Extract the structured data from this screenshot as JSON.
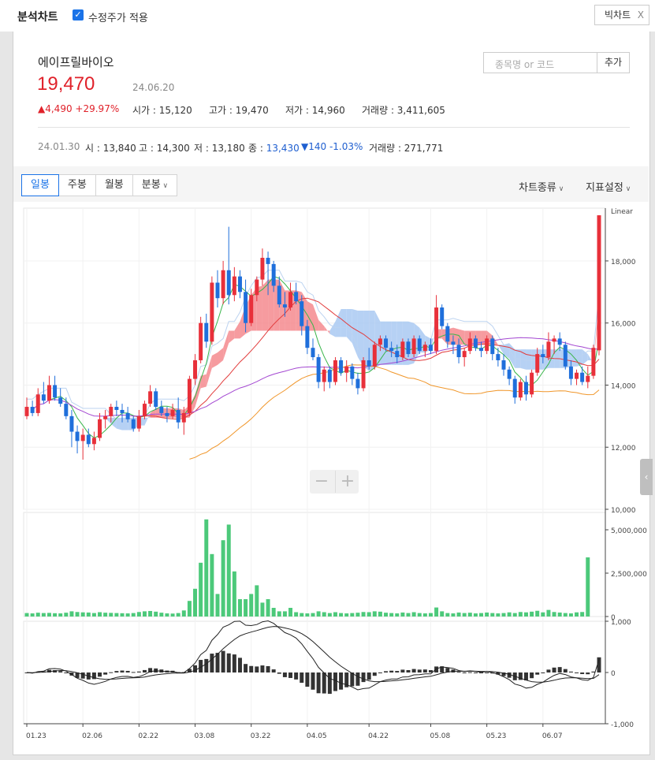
{
  "header": {
    "title": "분석차트",
    "adjust_label": "수정주가 적용",
    "big_chart_label": "빅차트",
    "close_glyph": "X"
  },
  "stock": {
    "name": "에이프릴바이오",
    "price": "19,470",
    "date": "24.06.20",
    "change": "4,490",
    "change_pct": "+29.97%",
    "open_label": "시가",
    "open": "15,120",
    "high_label": "고가",
    "high": "19,470",
    "low_label": "저가",
    "low": "14,960",
    "volume_label": "거래량",
    "volume": "3,411,605"
  },
  "search": {
    "placeholder": "종목명 or 코드",
    "add_label": "추가"
  },
  "history": {
    "date": "24.01.30",
    "open_label": "시",
    "open": "13,840",
    "high_label": "고",
    "high": "14,300",
    "low_label": "저",
    "low": "13,180",
    "close_label": "종",
    "close": "13,430",
    "change": "140",
    "change_pct": "-1.03%",
    "volume_label": "거래량",
    "volume": "271,771"
  },
  "tabs": [
    {
      "label": "일봉",
      "active": true
    },
    {
      "label": "주봉",
      "active": false
    },
    {
      "label": "월봉",
      "active": false
    },
    {
      "label": "분봉",
      "active": false
    }
  ],
  "menus": {
    "chart_type": "차트종류",
    "indicator": "지표설정"
  },
  "zoom": {
    "minus": "−",
    "plus": "+"
  },
  "colors": {
    "up": "#e8303a",
    "down": "#1f6fdb",
    "volume": "#4cc97a",
    "ma5": "#39b54a",
    "ma20": "#e23b3b",
    "ma60": "#a347d1",
    "ma120": "#f0962a",
    "cloud_up": "#f48a8e",
    "cloud_down": "#a9c9f2"
  },
  "chart_data": {
    "type": "candlestick",
    "price_axis": {
      "scale": "Linear",
      "ticks": [
        "18,000",
        "16,000",
        "14,000",
        "12,000",
        "10,000"
      ],
      "range": [
        10000,
        19700
      ]
    },
    "volume_axis": {
      "ticks": [
        "5,000,000",
        "2,500,000",
        "0"
      ],
      "range": [
        0,
        6000000
      ]
    },
    "macd_axis": {
      "ticks": [
        "1,000",
        "0",
        "-1,000"
      ],
      "range": [
        -1000,
        1000
      ]
    },
    "x_ticks": [
      "01.23",
      "02.06",
      "02.22",
      "03.08",
      "03.22",
      "04.05",
      "04.22",
      "05.08",
      "05.23",
      "06.07"
    ],
    "candles_ohlc": [
      [
        13000,
        13600,
        12900,
        13300
      ],
      [
        13300,
        13500,
        13000,
        13100
      ],
      [
        13100,
        13900,
        13000,
        13700
      ],
      [
        13700,
        14100,
        13400,
        13500
      ],
      [
        13500,
        14300,
        13400,
        14000
      ],
      [
        14000,
        14300,
        13500,
        13600
      ],
      [
        13600,
        13900,
        13300,
        13400
      ],
      [
        13400,
        13600,
        12900,
        13000
      ],
      [
        13000,
        13200,
        12000,
        12500
      ],
      [
        12500,
        12700,
        11800,
        12200
      ],
      [
        12200,
        12600,
        11600,
        12400
      ],
      [
        12400,
        12600,
        12000,
        12100
      ],
      [
        12100,
        12500,
        11900,
        12300
      ],
      [
        12300,
        13100,
        12200,
        12900
      ],
      [
        12900,
        13200,
        12600,
        13000
      ],
      [
        13000,
        13400,
        12800,
        13300
      ],
      [
        13300,
        13500,
        13000,
        13200
      ],
      [
        13200,
        13400,
        12800,
        13100
      ],
      [
        13100,
        13300,
        12800,
        12900
      ],
      [
        12900,
        13000,
        12500,
        12600
      ],
      [
        12600,
        13200,
        12500,
        13000
      ],
      [
        13000,
        13500,
        12900,
        13400
      ],
      [
        13400,
        14000,
        13300,
        13800
      ],
      [
        13800,
        13900,
        13200,
        13300
      ],
      [
        13300,
        13500,
        13000,
        13100
      ],
      [
        13100,
        13300,
        12800,
        13000
      ],
      [
        13000,
        13400,
        12900,
        13200
      ],
      [
        13200,
        13600,
        12600,
        12800
      ],
      [
        12800,
        13300,
        12400,
        13100
      ],
      [
        13100,
        14300,
        13000,
        14200
      ],
      [
        14200,
        15000,
        14000,
        14800
      ],
      [
        14800,
        16200,
        14700,
        16000
      ],
      [
        16000,
        16300,
        15200,
        15400
      ],
      [
        15400,
        17500,
        15300,
        17300
      ],
      [
        17300,
        17700,
        16500,
        16800
      ],
      [
        16800,
        18000,
        16600,
        17700
      ],
      [
        17700,
        19100,
        16600,
        16900
      ],
      [
        16900,
        17800,
        16700,
        17500
      ],
      [
        17500,
        17700,
        16800,
        17000
      ],
      [
        17000,
        17400,
        15700,
        16000
      ],
      [
        16000,
        17100,
        15900,
        16900
      ],
      [
        16900,
        17500,
        16700,
        17400
      ],
      [
        17400,
        18400,
        17200,
        18100
      ],
      [
        18100,
        18300,
        16900,
        17900
      ],
      [
        17900,
        18000,
        17000,
        17200
      ],
      [
        17200,
        17500,
        16500,
        16600
      ],
      [
        16600,
        17000,
        16200,
        16500
      ],
      [
        16500,
        17300,
        16400,
        17000
      ],
      [
        17000,
        17300,
        16600,
        16700
      ],
      [
        16700,
        16900,
        15600,
        15900
      ],
      [
        15900,
        16100,
        15000,
        15200
      ],
      [
        15200,
        15500,
        14800,
        14900
      ],
      [
        14900,
        15000,
        13900,
        14100
      ],
      [
        14100,
        14600,
        13800,
        14500
      ],
      [
        14500,
        14600,
        13900,
        14100
      ],
      [
        14100,
        14900,
        14000,
        14800
      ],
      [
        14800,
        14900,
        14300,
        14400
      ],
      [
        14400,
        14800,
        14100,
        14600
      ],
      [
        14600,
        14700,
        14000,
        14200
      ],
      [
        14200,
        14400,
        13700,
        13900
      ],
      [
        13900,
        14900,
        13800,
        14800
      ],
      [
        14800,
        15200,
        14500,
        14600
      ],
      [
        14600,
        15400,
        14500,
        15300
      ],
      [
        15300,
        15600,
        15100,
        15500
      ],
      [
        15500,
        15600,
        15100,
        15200
      ],
      [
        15200,
        15400,
        14900,
        15100
      ],
      [
        15100,
        15300,
        14700,
        14900
      ],
      [
        14900,
        15500,
        14800,
        15400
      ],
      [
        15400,
        15500,
        14900,
        15000
      ],
      [
        15000,
        15600,
        14900,
        15500
      ],
      [
        15500,
        15600,
        15000,
        15100
      ],
      [
        15100,
        15400,
        14900,
        15300
      ],
      [
        15300,
        15500,
        15000,
        15100
      ],
      [
        15100,
        16900,
        15000,
        16500
      ],
      [
        16500,
        16600,
        15800,
        15900
      ],
      [
        15900,
        16000,
        15200,
        15400
      ],
      [
        15400,
        15600,
        15000,
        15300
      ],
      [
        15300,
        15500,
        14700,
        14900
      ],
      [
        14900,
        15200,
        14600,
        15100
      ],
      [
        15100,
        15700,
        15000,
        15500
      ],
      [
        15500,
        15600,
        15100,
        15200
      ],
      [
        15200,
        15400,
        14900,
        15100
      ],
      [
        15100,
        15600,
        15000,
        15500
      ],
      [
        15500,
        15600,
        14800,
        15000
      ],
      [
        15000,
        15200,
        14600,
        14800
      ],
      [
        14800,
        15000,
        14300,
        14500
      ],
      [
        14500,
        14600,
        14000,
        14200
      ],
      [
        14200,
        14300,
        13400,
        13600
      ],
      [
        13600,
        14200,
        13500,
        14100
      ],
      [
        14100,
        14300,
        13500,
        13700
      ],
      [
        13700,
        14500,
        13600,
        14400
      ],
      [
        14400,
        15200,
        14300,
        15000
      ],
      [
        15000,
        15300,
        14700,
        14900
      ],
      [
        14900,
        15700,
        14800,
        15400
      ],
      [
        15400,
        15600,
        15000,
        15500
      ],
      [
        15500,
        15700,
        15100,
        15300
      ],
      [
        15300,
        15400,
        14500,
        14600
      ],
      [
        14600,
        14800,
        14000,
        14200
      ],
      [
        14200,
        14500,
        14000,
        14400
      ],
      [
        14400,
        14600,
        14000,
        14100
      ],
      [
        14100,
        14600,
        13900,
        14300
      ],
      [
        14300,
        15300,
        14200,
        15200
      ],
      [
        15120,
        19470,
        14960,
        19470
      ]
    ],
    "volume": [
      200,
      180,
      220,
      200,
      210,
      190,
      180,
      220,
      300,
      260,
      240,
      230,
      200,
      250,
      220,
      210,
      200,
      190,
      180,
      200,
      260,
      300,
      320,
      280,
      220,
      180,
      170,
      200,
      350,
      900,
      1600,
      3100,
      5600,
      3600,
      1300,
      4400,
      5300,
      2600,
      1000,
      1000,
      1300,
      1800,
      800,
      1000,
      500,
      300,
      300,
      500,
      250,
      200,
      180,
      200,
      300,
      250,
      200,
      250,
      200,
      180,
      200,
      220,
      260,
      250,
      300,
      280,
      220,
      200,
      180,
      230,
      200,
      250,
      200,
      180,
      200,
      520,
      300,
      200,
      180,
      230,
      200,
      220,
      180,
      200,
      230,
      200,
      180,
      200,
      240,
      200,
      260,
      240,
      280,
      330,
      240,
      380,
      260,
      230,
      200,
      180,
      240,
      260,
      3411
    ]
  }
}
